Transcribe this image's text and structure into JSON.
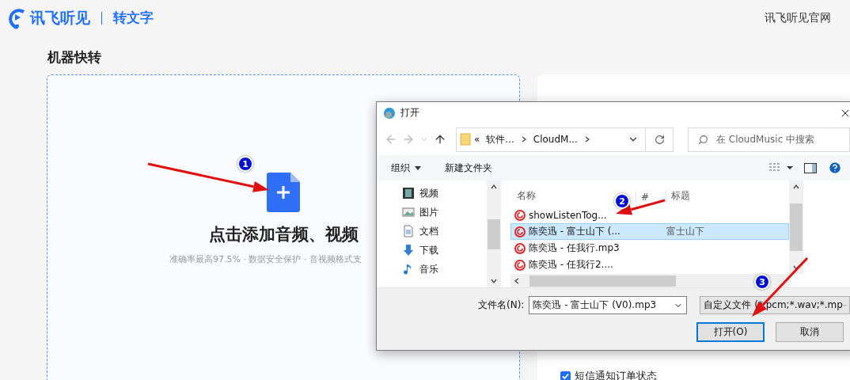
{
  "header": {
    "logo_text": "讯飞听见",
    "product": "转文字",
    "link": "讯飞听见官网"
  },
  "page_title": "机器快转",
  "upload": {
    "title": "点击添加音频、视频",
    "subtitle": "准确率最高97.5% · 数据安全保护 · 音视频格式支"
  },
  "settings": {
    "sms_notify": {
      "label": "短信通知订单状态",
      "checked": true
    }
  },
  "dialog": {
    "title": "打开",
    "path_prefix": "«",
    "breadcrumb": [
      "软件...",
      "CloudM..."
    ],
    "search": {
      "placeholder": "在 CloudMusic 中搜索"
    },
    "toolbar": {
      "organize": "组织",
      "new_folder": "新建文件夹"
    },
    "nav_items": [
      {
        "label": "视频",
        "kind": "video"
      },
      {
        "label": "图片",
        "kind": "image"
      },
      {
        "label": "文档",
        "kind": "document"
      },
      {
        "label": "下载",
        "kind": "download"
      },
      {
        "label": "音乐",
        "kind": "music"
      }
    ],
    "columns": [
      "名称",
      "#",
      "标题"
    ],
    "files": [
      {
        "name": "showListenTog...",
        "selected": false
      },
      {
        "name": "陈奕迅 - 富士山下 (...",
        "title": "富士山下",
        "selected": true
      },
      {
        "name": "陈奕迅 - 任我行.mp3",
        "selected": false
      },
      {
        "name": "陈奕迅 - 任我行2....",
        "selected": false
      }
    ],
    "file_name": {
      "label": "文件名(N):",
      "value": "陈奕迅 - 富士山下 (V0).mp3"
    },
    "file_type": {
      "value": "自定义文件 (*.pcm;*.wav;*.mp"
    },
    "buttons": [
      {
        "label": "打开(O)",
        "default": true
      },
      {
        "label": "取消",
        "default": false
      }
    ]
  },
  "annotations": [
    {
      "number": "1"
    },
    {
      "number": "2"
    },
    {
      "number": "3"
    }
  ]
}
